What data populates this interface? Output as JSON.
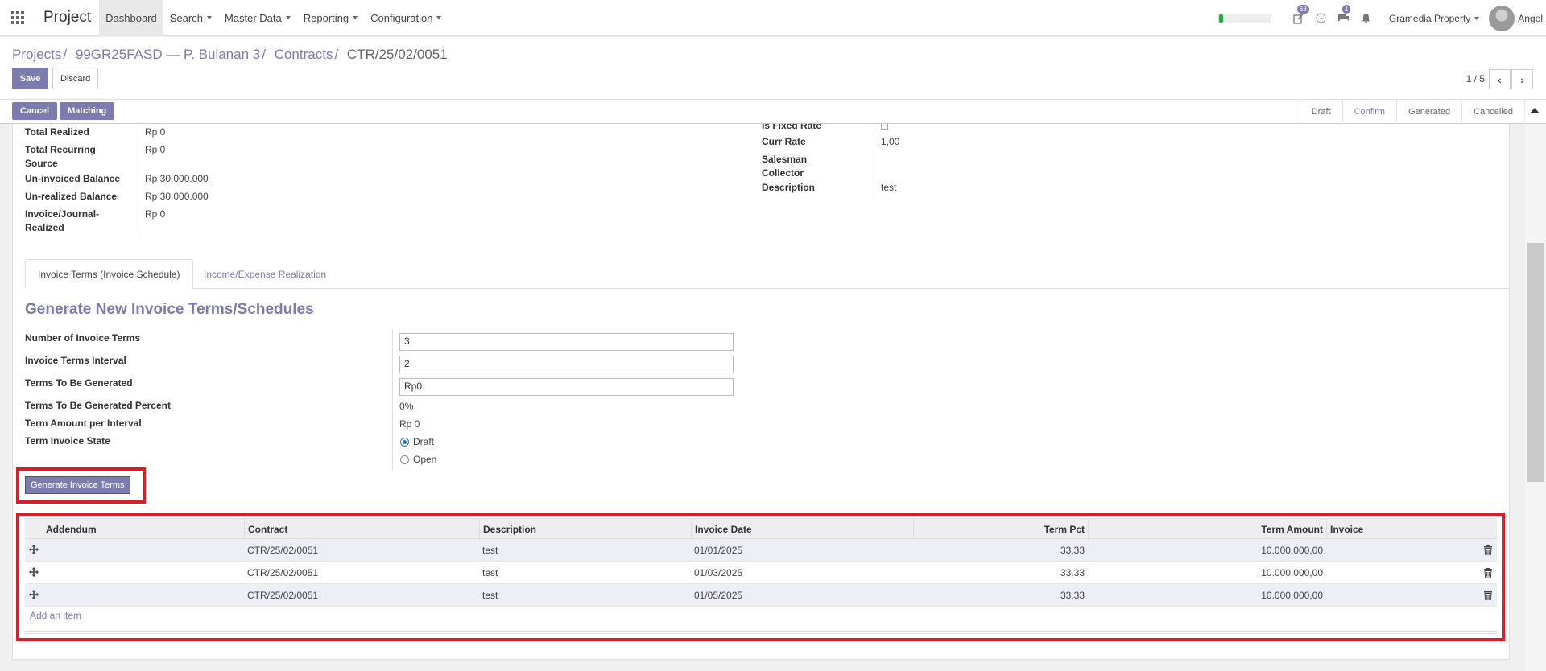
{
  "navbar": {
    "app_title": "Project",
    "menu": [
      "Dashboard",
      "Search",
      "Master Data",
      "Reporting",
      "Configuration"
    ],
    "activities_badge": "68",
    "messages_badge": "1",
    "company": "Gramedia Property",
    "user": "Angel",
    "progress": 0.08
  },
  "control_panel": {
    "breadcrumbs": [
      "Projects",
      "99GR25FASD — P. Bulanan 3",
      "Contracts",
      "CTR/25/02/0051"
    ],
    "save_label": "Save",
    "discard_label": "Discard",
    "pager_value": "1 / 5",
    "pager_prev": "‹",
    "pager_next": "›"
  },
  "statusbar": {
    "cancel_label": "Cancel",
    "matching_label": "Matching",
    "states": [
      "Draft",
      "Confirm",
      "Generated",
      "Cancelled"
    ],
    "active_state": "Confirm"
  },
  "left_fields": [
    {
      "label": "Total Realized",
      "value": "Rp 0"
    },
    {
      "label": "Total Recurring Source",
      "value": "Rp 0"
    },
    {
      "label": "Un-invoiced Balance",
      "value": "Rp 30.000.000"
    },
    {
      "label": "Un-realized Balance",
      "value": "Rp 30.000.000"
    },
    {
      "label": "Invoice/Journal-Realized",
      "value": "Rp 0"
    }
  ],
  "right_fields": [
    {
      "label": "Is Fixed Rate",
      "value": ""
    },
    {
      "label": "Curr Rate",
      "value": "1,00"
    },
    {
      "label": "Salesman",
      "value": ""
    },
    {
      "label": "Collector",
      "value": ""
    },
    {
      "label": "Description",
      "value": "test"
    }
  ],
  "tabs": [
    "Invoice Terms (Invoice Schedule)",
    "Income/Expense Realization"
  ],
  "generate": {
    "title": "Generate New Invoice Terms/Schedules",
    "number_label": "Number of Invoice Terms",
    "number_value": "3",
    "interval_label": "Invoice Terms Interval",
    "interval_value": "2",
    "to_generate_label": "Terms To Be Generated",
    "to_generate_value": "Rp0",
    "percent_label": "Terms To Be Generated Percent",
    "percent_value": "0%",
    "amount_label": "Term Amount per Interval",
    "amount_value": "Rp 0",
    "state_label": "Term Invoice State",
    "state_options": [
      "Draft",
      "Open"
    ],
    "state_selected": "Draft",
    "button_label": "Generate Invoice Terms"
  },
  "table": {
    "columns": [
      "Addendum",
      "Contract",
      "Description",
      "Invoice Date",
      "Term Pct",
      "Term Amount",
      "Invoice"
    ],
    "rows": [
      {
        "addendum": "",
        "contract": "CTR/25/02/0051",
        "description": "test",
        "invoice_date": "01/01/2025",
        "term_pct": "33,33",
        "term_amount": "10.000.000,00",
        "invoice": ""
      },
      {
        "addendum": "",
        "contract": "CTR/25/02/0051",
        "description": "test",
        "invoice_date": "01/03/2025",
        "term_pct": "33,33",
        "term_amount": "10.000.000,00",
        "invoice": ""
      },
      {
        "addendum": "",
        "contract": "CTR/25/02/0051",
        "description": "test",
        "invoice_date": "01/05/2025",
        "term_pct": "33,33",
        "term_amount": "10.000.000,00",
        "invoice": ""
      }
    ],
    "add_item_label": "Add an item"
  },
  "colors": {
    "primary": "#7c7bad",
    "highlight": "#d61f26"
  },
  "icons": [
    "apps-grid-icon",
    "activity-edit-icon",
    "clock-icon",
    "chat-icon",
    "bell-icon",
    "drag-handle-icon",
    "trash-icon",
    "scroll-top-icon"
  ]
}
